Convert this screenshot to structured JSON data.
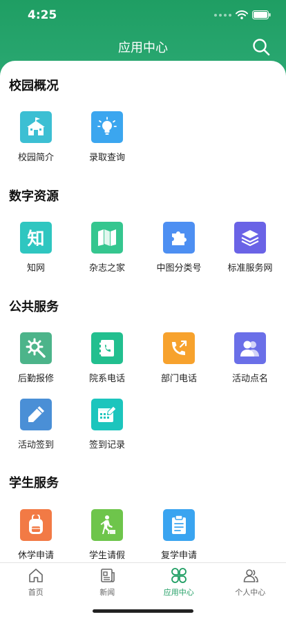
{
  "status_bar": {
    "time": "4:25"
  },
  "header": {
    "title": "应用中心"
  },
  "sections": [
    {
      "title": "校园概况",
      "items": [
        {
          "label": "校园简介",
          "icon": "school-icon",
          "color": "#3cbfd3"
        },
        {
          "label": "录取查询",
          "icon": "lightbulb-icon",
          "color": "#3ba6ef"
        }
      ]
    },
    {
      "title": "数字资源",
      "items": [
        {
          "label": "知网",
          "icon": "zhi-icon",
          "icon_text": "知",
          "color": "#2fc6c0"
        },
        {
          "label": "杂志之家",
          "icon": "book-icon",
          "color": "#35c68f"
        },
        {
          "label": "中图分类号",
          "icon": "puzzle-icon",
          "color": "#4d8ff2"
        },
        {
          "label": "标准服务网",
          "icon": "layers-icon",
          "color": "#6a63e6"
        }
      ]
    },
    {
      "title": "公共服务",
      "items": [
        {
          "label": "后勤报修",
          "icon": "repair-icon",
          "color": "#4cb48a"
        },
        {
          "label": "院系电话",
          "icon": "phonebook-icon",
          "color": "#22bf8f"
        },
        {
          "label": "部门电话",
          "icon": "phone-icon",
          "color": "#f7a22d"
        },
        {
          "label": "活动点名",
          "icon": "people-icon",
          "color": "#6a6fe8"
        },
        {
          "label": "活动签到",
          "icon": "pencil-icon",
          "color": "#4a8fd6"
        },
        {
          "label": "签到记录",
          "icon": "calendar-icon",
          "color": "#1cc5bd"
        }
      ]
    },
    {
      "title": "学生服务",
      "items": [
        {
          "label": "休学申请",
          "icon": "backpack-icon",
          "color": "#f27a45"
        },
        {
          "label": "学生请假",
          "icon": "walking-icon",
          "color": "#6ec54b"
        },
        {
          "label": "复学申请",
          "icon": "clipboard-icon",
          "color": "#3aa4f0"
        }
      ]
    }
  ],
  "tab_bar": [
    {
      "label": "首页",
      "icon": "home-icon",
      "active": false
    },
    {
      "label": "新闻",
      "icon": "news-icon",
      "active": false
    },
    {
      "label": "应用中心",
      "icon": "apps-icon",
      "active": true
    },
    {
      "label": "个人中心",
      "icon": "user-icon",
      "active": false
    }
  ]
}
